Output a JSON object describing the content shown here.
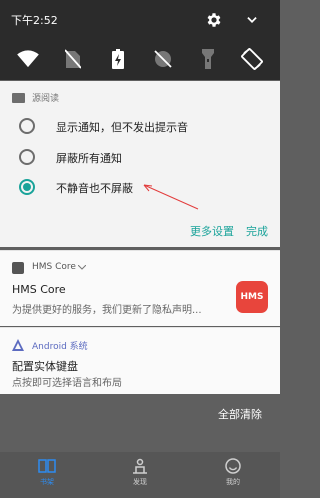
{
  "status": {
    "time": "下午2:52"
  },
  "quick_settings": [
    "wifi-icon",
    "no-sim-icon",
    "battery-charging-icon",
    "data-off-icon",
    "flashlight-icon",
    "auto-rotate-icon"
  ],
  "notification_settings": {
    "app_name": "源阅读",
    "options": [
      {
        "label": "显示通知，但不发出提示音",
        "selected": false
      },
      {
        "label": "屏蔽所有通知",
        "selected": false
      },
      {
        "label": "不静音也不屏蔽",
        "selected": true
      }
    ],
    "more_settings": "更多设置",
    "done": "完成"
  },
  "hms_card": {
    "app": "HMS Core",
    "title": "HMS Core",
    "body": "为提供更好的服务，我们更新了隐私声明...",
    "icon_text": "HMS",
    "icon_color": "#e8453c"
  },
  "android_card": {
    "app": "Android 系统",
    "title": "配置实体键盘",
    "body": "点按即可选择语言和布局"
  },
  "clear_all": "全部清除",
  "bottom_tabs": [
    {
      "label": "书架",
      "active": true
    },
    {
      "label": "发现",
      "active": false
    },
    {
      "label": "我的",
      "active": false
    }
  ],
  "accent_color": "#1aa39a"
}
